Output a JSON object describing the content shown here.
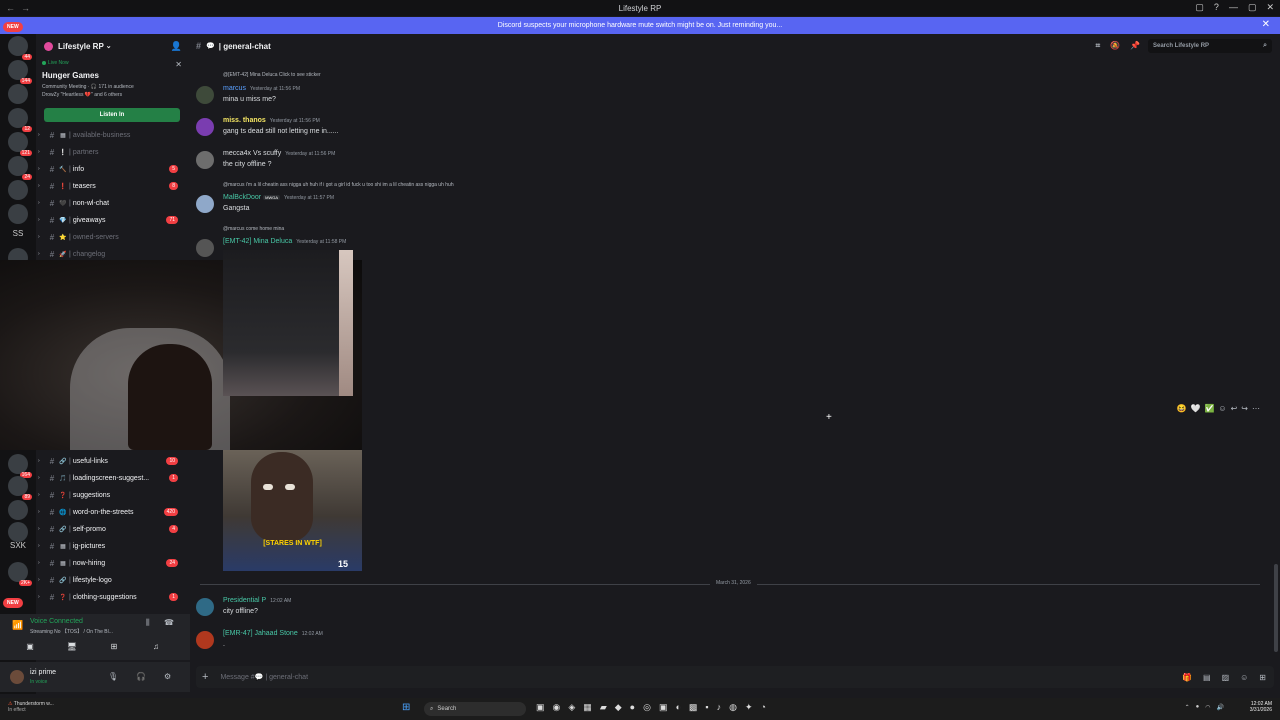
{
  "window": {
    "title": "Lifestyle RP",
    "controls": [
      "▢",
      "?",
      "—",
      "▢",
      "✕"
    ]
  },
  "notice": {
    "text": "Discord suspects your microphone hardware mute switch might be on. Just reminding you..."
  },
  "server_rail": {
    "new_label": "NEW",
    "badges": [
      "44",
      "144",
      "12",
      "121",
      "24"
    ],
    "text_items": [
      "SS",
      "SXK"
    ],
    "lower_badges": [
      "164",
      "89",
      "2K+"
    ]
  },
  "guild": {
    "name": "Lifestyle RP"
  },
  "live_event": {
    "live_label": "Live Now",
    "title": "Hunger Games",
    "meta_line1": "Community Meeting · 🎧 171 in audience",
    "meta_line2": "DrowZy \"Heartless 💔\" and 6 others",
    "listen_label": "Listen In"
  },
  "channels_top": [
    {
      "emoji": "▦",
      "name": "available-business",
      "muted": true,
      "badge": ""
    },
    {
      "emoji": "❕",
      "name": "partners",
      "muted": true,
      "badge": ""
    },
    {
      "emoji": "🔨",
      "name": "info",
      "muted": false,
      "badge": "5"
    },
    {
      "emoji": "❗",
      "name": "teasers",
      "muted": false,
      "badge": "8"
    },
    {
      "emoji": "🖤",
      "name": "non-wl-chat",
      "muted": false,
      "badge": ""
    },
    {
      "emoji": "💎",
      "name": "giveaways",
      "muted": false,
      "badge": "71"
    },
    {
      "emoji": "⭐",
      "name": "owned-servers",
      "muted": true,
      "badge": ""
    },
    {
      "emoji": "🚀",
      "name": "changelog",
      "muted": true,
      "badge": ""
    }
  ],
  "channels_bottom": [
    {
      "emoji": "🔗",
      "name": "useful-links",
      "badge": "10"
    },
    {
      "emoji": "🎵",
      "name": "loadingscreen-suggest...",
      "badge": "1"
    },
    {
      "emoji": "❓",
      "name": "suggestions",
      "badge": ""
    },
    {
      "emoji": "🌐",
      "name": "word-on-the-streets",
      "badge": "420"
    },
    {
      "emoji": "🔗",
      "name": "self-promo",
      "badge": "4"
    },
    {
      "emoji": "▦",
      "name": "ig-pictures",
      "badge": ""
    },
    {
      "emoji": "▦",
      "name": "now-hiring",
      "badge": "24"
    },
    {
      "emoji": "🔗",
      "name": "lifestyle-logo",
      "badge": ""
    },
    {
      "emoji": "❓",
      "name": "clothing-suggestions",
      "badge": "1"
    }
  ],
  "voice": {
    "title": "Voice Connected",
    "subtitle": "Streaming No 【TOS】 / On The Bl..."
  },
  "user": {
    "name": "izi prime",
    "status": "In voice"
  },
  "channel": {
    "name": "general-chat",
    "search_placeholder": "Search Lifestyle RP"
  },
  "messages": [
    {
      "reply": "@[EMT-42] Mina Deluca Click to see sticker",
      "name": "",
      "time": "",
      "text": ""
    },
    {
      "reply": "",
      "name": "marcus",
      "time": "Yesterday at 11:56 PM",
      "text": "mina u miss me?",
      "color": "#5aa0ff"
    },
    {
      "reply": "",
      "name": "miss. thanos",
      "time": "Yesterday at 11:56 PM",
      "text": "gang ts dead still not letting me in......",
      "color": "#f5e663"
    },
    {
      "reply": "",
      "name": "mecca4x Vs scuffy",
      "time": "Yesterday at 11:56 PM",
      "text": "the city offline ?",
      "color": "#dbdee1"
    },
    {
      "reply": "@marcus i'm a lil cheatin ass nigga uh huh if i got a girl id fuck u too shi im a lil cheatin ass nigga uh huh",
      "name": "MalBckDoor",
      "tag": "MWGA",
      "time": "Yesterday at 11:57 PM",
      "text": "Gangsta",
      "color": "#48c7a6"
    },
    {
      "reply": "@marcus come home mina",
      "name": "[EMT-42] Mina Deluca",
      "time": "Yesterday at 11:58 PM",
      "text": "",
      "color": "#48c7a6"
    }
  ],
  "meme_caption": "[STARES IN WTF]",
  "meme_number": "15",
  "date_divider": "March 31, 2026",
  "recent_messages": [
    {
      "name": "Presidential P",
      "time": "12:02 AM",
      "text": "city offline?",
      "color": "#48c7a6"
    },
    {
      "name": "[EMR-47] Jahaad Stone",
      "time": "12:02 AM",
      "text": ".",
      "color": "#48c7a6"
    }
  ],
  "composer": {
    "placeholder": "Message #💬 | general-chat"
  },
  "taskbar": {
    "weather_title": "Thunderstorm w...",
    "weather_sub": "In effect",
    "search_label": "Search",
    "time": "12:02 AM",
    "date": "3/31/2026"
  }
}
